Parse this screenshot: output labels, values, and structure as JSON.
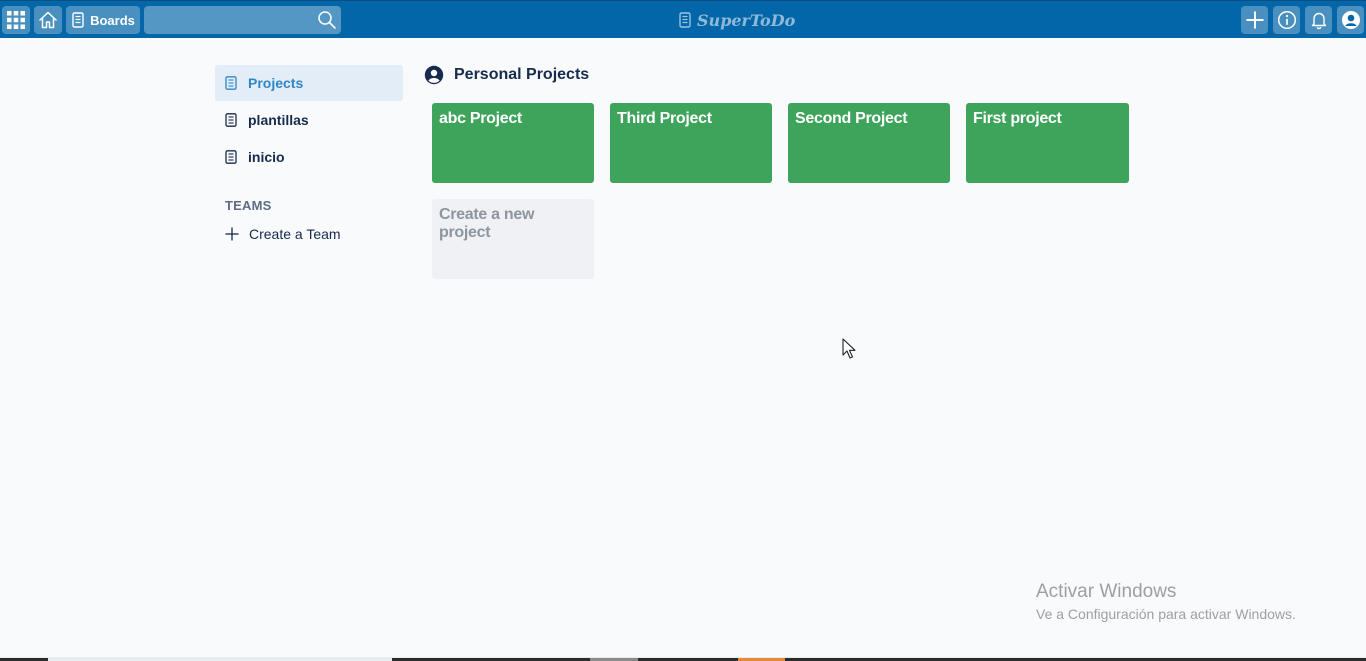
{
  "topbar": {
    "boards_label": "Boards",
    "search_placeholder": "",
    "logo_text": "SuperToDo",
    "colors": {
      "bar": "#0366a8",
      "button_bg": "rgba(255,255,255,0.28)"
    },
    "icons": [
      "apps-grid-icon",
      "home-icon",
      "boards-icon",
      "search-icon",
      "plus-icon",
      "info-icon",
      "bell-icon",
      "user-avatar-icon"
    ]
  },
  "sidebar": {
    "items": [
      {
        "label": "Projects",
        "active": true,
        "icon": "board-icon"
      },
      {
        "label": "plantillas",
        "active": false,
        "icon": "board-icon"
      },
      {
        "label": "inicio",
        "active": false,
        "icon": "board-icon"
      }
    ],
    "teams_heading": "TEAMS",
    "create_team_label": "Create a Team",
    "active_color": "#2f87c8"
  },
  "main": {
    "section_title": "Personal Projects",
    "section_icon": "user-circle-icon",
    "projects": [
      {
        "title": "abc Project"
      },
      {
        "title": "Third Project"
      },
      {
        "title": "Second Project"
      },
      {
        "title": "First project"
      }
    ],
    "create_project_label": "Create a new project",
    "card_color": "#3fa45b"
  },
  "watermark": {
    "title": "Activar Windows",
    "subtitle": "Ve a Configuración para activar Windows."
  }
}
